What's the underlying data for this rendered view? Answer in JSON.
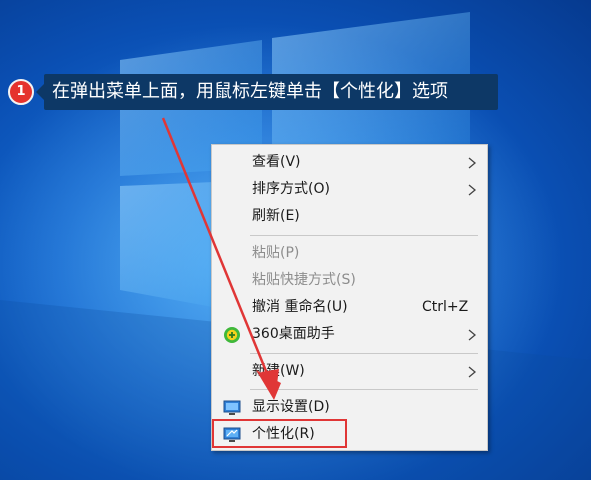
{
  "callout": {
    "step_number": "1",
    "text": "在弹出菜单上面，用鼠标左键单击【个性化】选项"
  },
  "context_menu": {
    "items": [
      {
        "label": "查看(V)",
        "has_submenu": true
      },
      {
        "label": "排序方式(O)",
        "has_submenu": true
      },
      {
        "label": "刷新(E)"
      },
      {
        "label": "粘贴(P)",
        "disabled": true
      },
      {
        "label": "粘贴快捷方式(S)",
        "disabled": true
      },
      {
        "label": "撤消 重命名(U)",
        "shortcut": "Ctrl+Z"
      },
      {
        "label": "360桌面助手",
        "icon": "360-icon",
        "has_submenu": true
      },
      {
        "label": "新建(W)",
        "has_submenu": true
      },
      {
        "label": "显示设置(D)",
        "icon": "display-settings-icon"
      },
      {
        "label": "个性化(R)",
        "icon": "personalize-icon",
        "highlighted": true
      }
    ]
  },
  "colors": {
    "callout_badge": "#e5322d",
    "callout_background": "#0d3866",
    "highlight_border": "#e03636",
    "arrow": "#e03636",
    "menu_background": "#f2f2f2",
    "disabled_text": "#8d8d8d"
  }
}
